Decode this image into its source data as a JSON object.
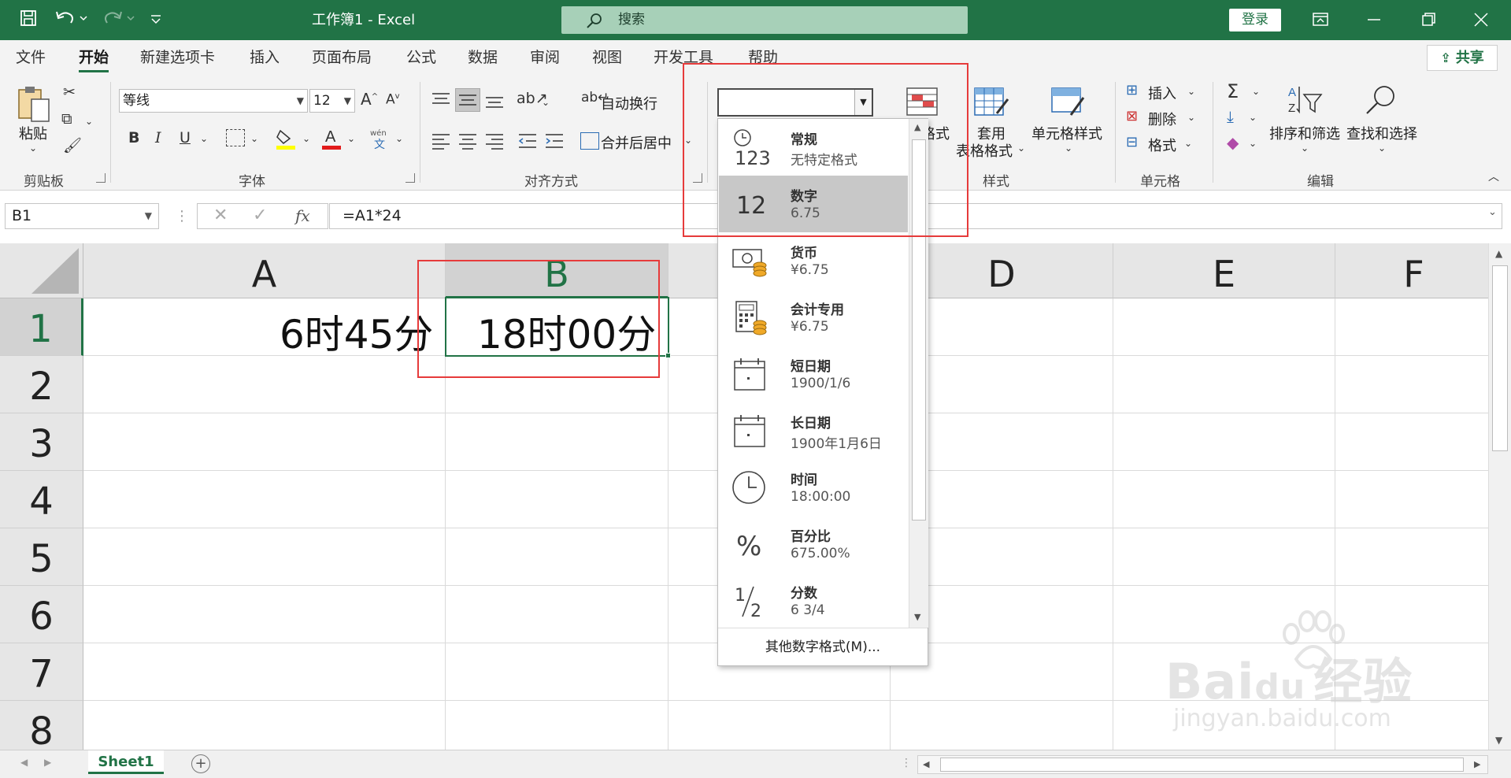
{
  "titlebar": {
    "title": "工作簿1  -  Excel",
    "search_placeholder": "搜索",
    "login": "登录",
    "bg": "#217346"
  },
  "tabs": [
    {
      "label": "文件"
    },
    {
      "label": "开始"
    },
    {
      "label": "新建选项卡"
    },
    {
      "label": "插入"
    },
    {
      "label": "页面布局"
    },
    {
      "label": "公式"
    },
    {
      "label": "数据"
    },
    {
      "label": "审阅"
    },
    {
      "label": "视图"
    },
    {
      "label": "开发工具"
    },
    {
      "label": "帮助"
    }
  ],
  "share": "共享",
  "ribbon": {
    "clipboard": {
      "paste": "粘贴",
      "label": "剪贴板"
    },
    "font": {
      "name": "等线",
      "size": "12",
      "label": "字体",
      "bold": "B",
      "italic": "I",
      "underline": "U"
    },
    "alignment": {
      "wrap": "自动换行",
      "merge": "合并后居中",
      "label": "对齐方式"
    },
    "styles": {
      "format_table_1": "套用",
      "format_table_2": "表格格式",
      "cell_styles": "单元格样式",
      "cond_fmt_fragment": "格式",
      "label": "样式"
    },
    "cells": {
      "insert": "插入",
      "delete": "删除",
      "format": "格式",
      "label": "单元格"
    },
    "editing": {
      "sort_filter": "排序和筛选",
      "find_select": "查找和选择",
      "label": "编辑"
    }
  },
  "formula_bar": {
    "name_box": "B1",
    "formula": "=A1*24",
    "fx": "fx"
  },
  "grid": {
    "columns": [
      "A",
      "B",
      "C",
      "D",
      "E",
      "F"
    ],
    "rows": [
      "1",
      "2",
      "3",
      "4",
      "5",
      "6",
      "7",
      "8"
    ],
    "selected_column": "B",
    "selected_row": "1",
    "cells": {
      "A1": "6时45分",
      "B1": "18时00分"
    }
  },
  "number_format_dropdown": {
    "items": [
      {
        "name": "常规",
        "example": "无特定格式",
        "icon": "clock-123-icon"
      },
      {
        "name": "数字",
        "example": "6.75",
        "icon": "number-12-icon",
        "selected": true
      },
      {
        "name": "货币",
        "example": "¥6.75",
        "icon": "currency-icon"
      },
      {
        "name": "会计专用",
        "example": " ¥6.75",
        "icon": "accounting-icon"
      },
      {
        "name": "短日期",
        "example": "1900/1/6",
        "icon": "calendar-icon"
      },
      {
        "name": "长日期",
        "example": "1900年1月6日",
        "icon": "calendar-icon"
      },
      {
        "name": "时间",
        "example": "18:00:00",
        "icon": "clock-icon"
      },
      {
        "name": "百分比",
        "example": "675.00%",
        "icon": "percent-icon"
      },
      {
        "name": "分数",
        "example": "6 3/4",
        "icon": "fraction-icon"
      }
    ],
    "more": "其他数字格式(M)..."
  },
  "sheets": [
    "Sheet1"
  ],
  "watermark": {
    "main": "Bai",
    "mark": "du",
    "cn": "经验",
    "url": "jingyan.baidu.com"
  },
  "colors": {
    "accent": "#217346",
    "highlight": "#e63b3b",
    "font_color": "#e21b1b",
    "fill_color": "#ffff00"
  }
}
